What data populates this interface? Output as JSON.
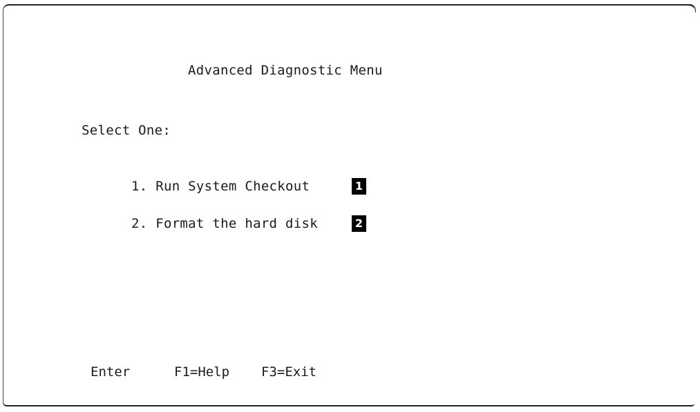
{
  "menu": {
    "title": "Advanced Diagnostic Menu",
    "prompt": "Select One:",
    "options": [
      {
        "label": "1. Run System Checkout",
        "badge": "1"
      },
      {
        "label": "2. Format the hard disk",
        "badge": "2"
      }
    ]
  },
  "function_keys": {
    "enter": "Enter",
    "help": "F1=Help",
    "exit": "F3=Exit"
  },
  "colors": {
    "text": "#1a1a1a",
    "badge_background": "#000000",
    "badge_text": "#ffffff",
    "background": "#ffffff"
  }
}
